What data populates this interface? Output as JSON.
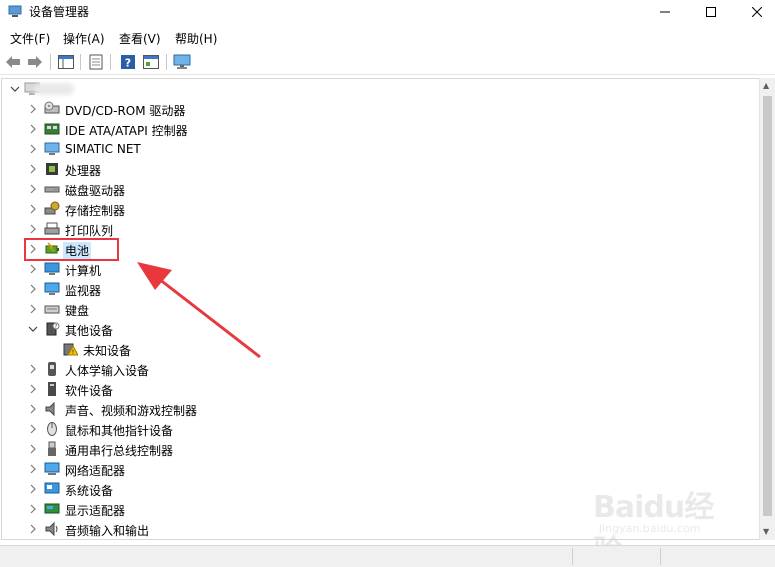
{
  "window": {
    "title": "设备管理器",
    "controls": {
      "minimize": "─",
      "maximize": "☐",
      "close": "✕"
    }
  },
  "menu": [
    {
      "label": "文件(F)"
    },
    {
      "label": "操作(A)"
    },
    {
      "label": "查看(V)"
    },
    {
      "label": "帮助(H)"
    }
  ],
  "toolbar": {
    "buttons": [
      "back-arrow-icon",
      "forward-arrow-icon",
      "show-hide-tree-icon",
      "properties-icon",
      "help-icon",
      "run-action-icon",
      "computer-monitor-icon"
    ]
  },
  "tree": {
    "root_label": "",
    "items": [
      {
        "label": "DVD/CD-ROM 驱动器",
        "icon": "dvd-drive-icon",
        "expanded": false
      },
      {
        "label": "IDE ATA/ATAPI 控制器",
        "icon": "ide-controller-icon",
        "expanded": false
      },
      {
        "label": "SIMATIC NET",
        "icon": "network-monitor-icon",
        "expanded": false
      },
      {
        "label": "处理器",
        "icon": "processor-icon",
        "expanded": false
      },
      {
        "label": "磁盘驱动器",
        "icon": "disk-drive-icon",
        "expanded": false
      },
      {
        "label": "存储控制器",
        "icon": "storage-controller-icon",
        "expanded": false
      },
      {
        "label": "打印队列",
        "icon": "print-queue-icon",
        "expanded": false
      },
      {
        "label": "电池",
        "icon": "battery-icon",
        "expanded": false,
        "selected": true
      },
      {
        "label": "计算机",
        "icon": "computer-icon",
        "expanded": false
      },
      {
        "label": "监视器",
        "icon": "monitor-icon",
        "expanded": false
      },
      {
        "label": "键盘",
        "icon": "keyboard-icon",
        "expanded": false
      },
      {
        "label": "其他设备",
        "icon": "other-devices-icon",
        "expanded": true
      },
      {
        "label": "未知设备",
        "icon": "unknown-device-warning-icon",
        "child": true
      },
      {
        "label": "人体学输入设备",
        "icon": "hid-icon",
        "expanded": false
      },
      {
        "label": "软件设备",
        "icon": "software-device-icon",
        "expanded": false
      },
      {
        "label": "声音、视频和游戏控制器",
        "icon": "speaker-icon",
        "expanded": false
      },
      {
        "label": "鼠标和其他指针设备",
        "icon": "mouse-icon",
        "expanded": false
      },
      {
        "label": "通用串行总线控制器",
        "icon": "usb-icon",
        "expanded": false
      },
      {
        "label": "网络适配器",
        "icon": "network-adapter-icon",
        "expanded": false
      },
      {
        "label": "系统设备",
        "icon": "system-device-icon",
        "expanded": false
      },
      {
        "label": "显示适配器",
        "icon": "display-adapter-icon",
        "expanded": false
      },
      {
        "label": "音频输入和输出",
        "icon": "audio-io-icon",
        "expanded": false
      }
    ]
  },
  "annotation": {
    "color": "#e8383d"
  },
  "watermark": {
    "text": "Baidu经验",
    "sub": "jingyan.baidu.com"
  },
  "colors": {
    "selection": "#cce8ff",
    "annotation_red": "#e8383d"
  }
}
